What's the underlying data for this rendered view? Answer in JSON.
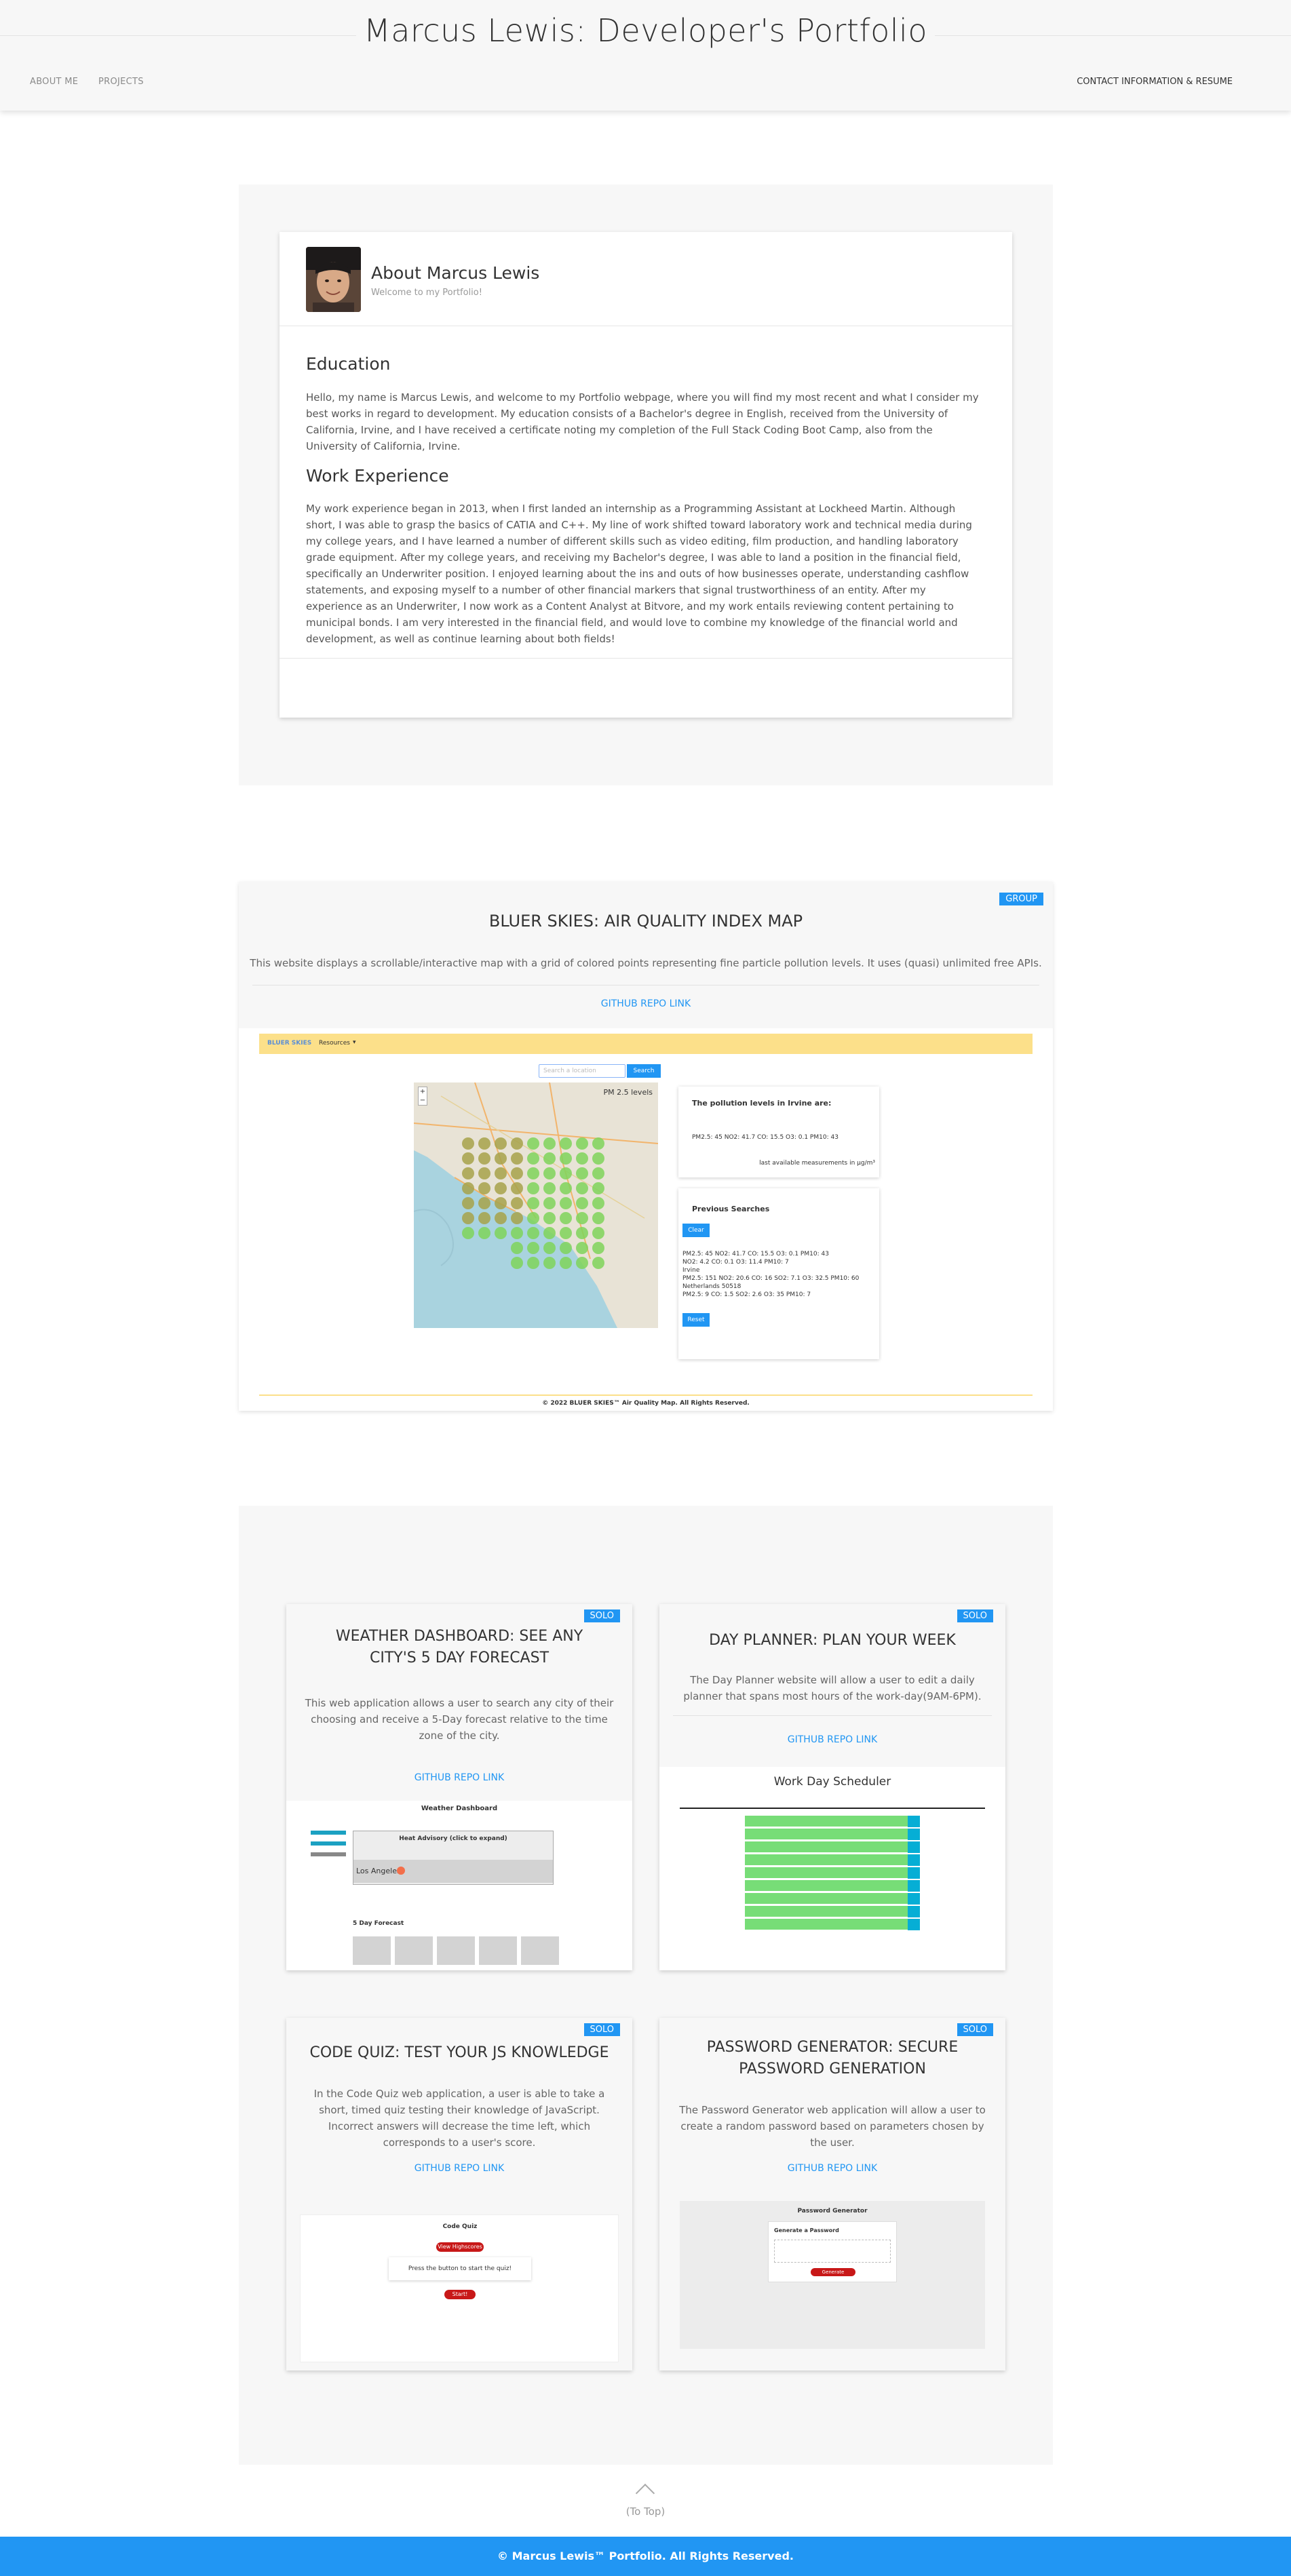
{
  "header": {
    "title": "Marcus Lewis: Developer's Portfolio",
    "nav": [
      "ABOUT ME",
      "PROJECTS"
    ],
    "nav_right": "CONTACT INFORMATION & RESUME"
  },
  "about": {
    "title": "About Marcus Lewis",
    "subtitle": "Welcome to my Portfolio!",
    "education_heading": "Education",
    "education_text": "Hello, my name is Marcus Lewis, and welcome to my Portfolio webpage, where you will find my most recent and what I consider my best works in regard to development. My education consists of a Bachelor's degree in English, received from the University of California, Irvine, and I have received a certificate noting my completion of the Full Stack Coding Boot Camp, also from the University of California, Irvine.",
    "work_heading": "Work Experience",
    "work_text": "My work experience began in 2013, when I first landed an internship as a Programming Assistant at Lockheed Martin. Although short, I was able to grasp the basics of CATIA and C++. My line of work shifted toward laboratory work and technical media during my college years, and I have learned a number of different skills such as video editing, film production, and handling laboratory grade equipment. After my college years, and receiving my Bachelor's degree, I was able to land a position in the financial field, specifically an Underwriter position. I enjoyed learning about the ins and outs of how businesses operate, understanding cashflow statements, and exposing myself to a number of other financial markers that signal trustworthiness of an entity. After my experience as an Underwriter, I now work as a Content Analyst at Bitvore, and my work entails reviewing content pertaining to municipal bonds. I am very interested in the financial field, and would love to combine my knowledge of the financial world and development, as well as continue learning about both fields!"
  },
  "projects": {
    "featured": {
      "badge": "GROUP",
      "title": "BLUER SKIES: AIR QUALITY INDEX MAP",
      "description": "This website displays a scrollable/interactive map with a grid of colored points representing fine particle pollution levels. It uses (quasi) unlimited free APIs.",
      "link": "GITHUB REPO LINK",
      "shot": {
        "logo": "BLUER SKIES",
        "menu": "Resources",
        "search_placeholder": "Search a location",
        "search_btn": "Search",
        "map_label": "PM 2.5 levels",
        "levels_title": "The pollution levels in Irvine are:",
        "levels_values": "PM2.5: 45   NO2: 41.7   CO: 15.5   O3: 0.1   PM10: 43",
        "levels_note": "last available measurements in μg/m³",
        "prev_title": "Previous Searches",
        "clear_btn": "Clear",
        "prev_lines": [
          "PM2.5: 45  NO2: 41.7  CO: 15.5  O3: 0.1  PM10: 43",
          "NO2: 4.2  CO: 0.1  O3: 11.4  PM10: 7",
          "Irvine",
          "PM2.5: 151  NO2: 20.6  CO: 16  SO2: 7.1  O3: 32.5  PM10: 60",
          "Netherlands 50518",
          "PM2.5: 9  CO: 1.5  SO2: 2.6  O3: 35  PM10: 7"
        ],
        "reset_btn": "Reset",
        "footer": "© 2022 BLUER SKIES™ Air Quality Map. All Rights Reserved."
      }
    },
    "cards": [
      {
        "badge": "SOLO",
        "title": "WEATHER DASHBOARD: SEE ANY CITY'S 5 DAY FORECAST",
        "description": "This web application allows a user to search any city of their choosing and receive a 5-Day forecast relative to the time zone of the city.",
        "link": "GITHUB REPO LINK",
        "shot_title": "Weather Dashboard",
        "shot_alert": "Heat Advisory (click to expand)",
        "shot_city": "Los Angeles",
        "shot_forecast": "5 Day Forecast"
      },
      {
        "badge": "SOLO",
        "title": "DAY PLANNER: PLAN YOUR WEEK",
        "description": "The Day Planner website will allow a user to edit a daily planner that spans most hours of the work-day(9AM-6PM).",
        "link": "GITHUB REPO LINK",
        "shot_title": "Work Day Scheduler"
      },
      {
        "badge": "SOLO",
        "title": "CODE QUIZ: TEST YOUR JS KNOWLEDGE",
        "description": "In the Code Quiz web application, a user is able to take a short, timed quiz testing their knowledge of JavaScript. Incorrect answers will decrease the time left, which corresponds to a user's score.",
        "link": "GITHUB REPO LINK",
        "shot_title": "Code Quiz",
        "shot_btn1": "View Highscores",
        "shot_prompt": "Press the button to start the quiz!",
        "shot_btn2": "Start!"
      },
      {
        "badge": "SOLO",
        "title": "PASSWORD GENERATOR: SECURE PASSWORD GENERATION",
        "description": "The Password Generator web application will allow a user to create a random password based on parameters chosen by the user.",
        "link": "GITHUB REPO LINK",
        "shot_title": "Password Generator",
        "shot_sub": "Generate a Password",
        "shot_btn": "Generate Password"
      }
    ]
  },
  "totop": "(To Top)",
  "footer": "© Marcus Lewis™ Portfolio. All Rights Reserved."
}
